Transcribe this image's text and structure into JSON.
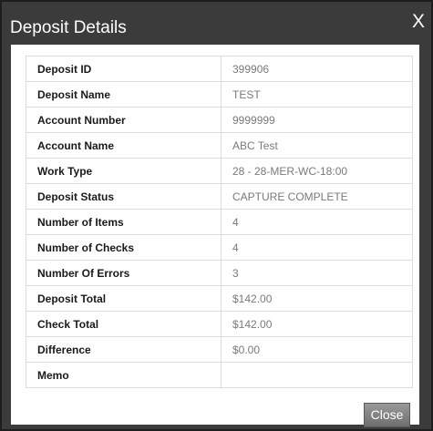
{
  "dialog": {
    "title": "Deposit Details",
    "close_glyph": "X",
    "close_button_label": "Close"
  },
  "details": [
    {
      "label": "Deposit ID",
      "value": "399906"
    },
    {
      "label": "Deposit Name",
      "value": "TEST"
    },
    {
      "label": "Account Number",
      "value": "9999999"
    },
    {
      "label": "Account Name",
      "value": "ABC Test"
    },
    {
      "label": "Work Type",
      "value": "28 - 28-MER-WC-18:00"
    },
    {
      "label": "Deposit Status",
      "value": "CAPTURE COMPLETE"
    },
    {
      "label": "Number of Items",
      "value": "4"
    },
    {
      "label": "Number of Checks",
      "value": "4"
    },
    {
      "label": "Number Of Errors",
      "value": "3"
    },
    {
      "label": "Deposit Total",
      "value": "$142.00"
    },
    {
      "label": "Check Total",
      "value": "$142.00"
    },
    {
      "label": "Difference",
      "value": "$0.00"
    },
    {
      "label": "Memo",
      "value": ""
    }
  ]
}
